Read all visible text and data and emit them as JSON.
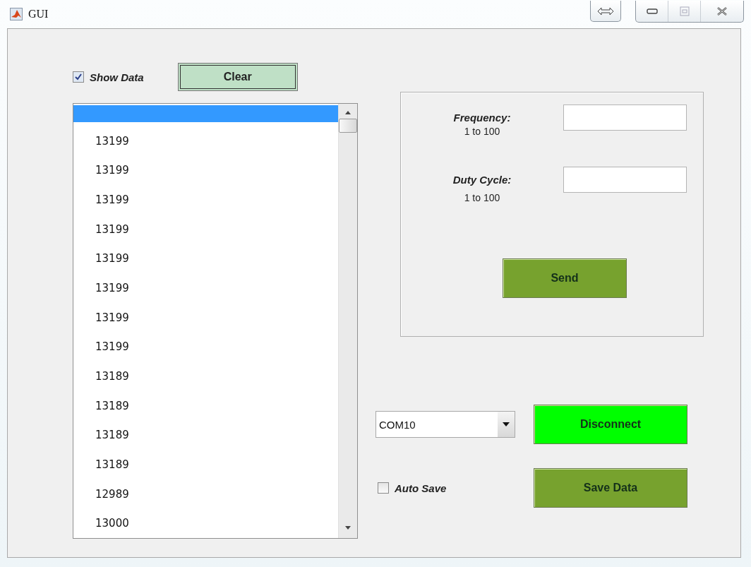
{
  "window": {
    "title": "GUI"
  },
  "show_data": {
    "label": "Show Data",
    "checked": true
  },
  "clear_button": {
    "label": "Clear"
  },
  "data_list": {
    "items": [
      {
        "selected": true
      },
      {
        "text": "13199",
        "selected": false
      },
      {
        "text": "13199",
        "selected": false
      },
      {
        "text": "13199",
        "selected": false
      },
      {
        "text": "13199",
        "selected": false
      },
      {
        "text": "13199",
        "selected": false
      },
      {
        "text": "13199",
        "selected": false
      },
      {
        "text": "13199",
        "selected": false
      },
      {
        "text": "13199",
        "selected": false
      },
      {
        "text": "13189",
        "selected": false
      },
      {
        "text": "13189",
        "selected": false
      },
      {
        "text": "13189",
        "selected": false
      },
      {
        "text": "13189",
        "selected": false
      },
      {
        "text": "12989",
        "selected": false
      },
      {
        "text": "13000",
        "selected": false
      }
    ]
  },
  "settings": {
    "fields": [
      {
        "label": "Frequency:",
        "range": "1 to 100"
      },
      {
        "label": "Duty Cycle:",
        "range": "1 to 100"
      }
    ],
    "send_button": "Send"
  },
  "port": {
    "value": "COM10"
  },
  "connect_button": {
    "label": "Disconnect",
    "active": true
  },
  "auto_save": {
    "label": "Auto Save",
    "checked": false
  },
  "save_button": {
    "label": "Save Data"
  }
}
